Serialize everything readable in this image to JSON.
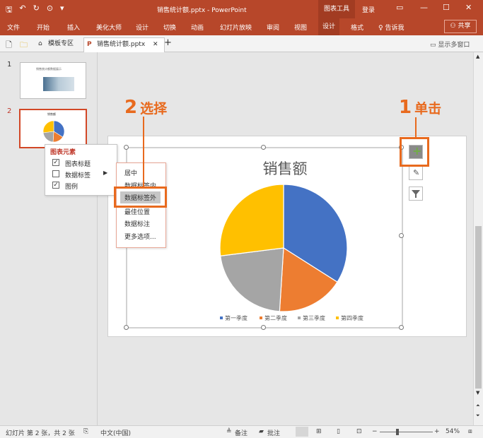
{
  "titlebar": {
    "title": "销售统计额.pptx  -  PowerPoint",
    "tools_tab": "图表工具",
    "login": "登录",
    "buttons": [
      "▭",
      "—",
      "☐",
      "✕"
    ]
  },
  "ribbon": {
    "tabs": [
      "文件",
      "开始",
      "插入",
      "美化大师",
      "设计",
      "切换",
      "动画",
      "幻灯片放映",
      "审阅",
      "视图",
      "设计",
      "格式"
    ],
    "tell_me": "告诉我",
    "share": "共享"
  },
  "tabbar": {
    "tabs": [
      "模板专区",
      "销售统计额.pptx"
    ],
    "multi_window": "显示多窗口"
  },
  "thumbnails": {
    "slide_numbers": [
      "1",
      "2"
    ],
    "slide1_title": "销售统计额数据展示",
    "slide2_title": "销售额"
  },
  "chart_elements_popup": {
    "header": "图表元素",
    "items": [
      {
        "label": "图表标题",
        "checked": true
      },
      {
        "label": "数据标签",
        "checked": false
      },
      {
        "label": "图例",
        "checked": true
      }
    ]
  },
  "label_submenu": {
    "items": [
      "居中",
      "数据标签内",
      "数据标签外",
      "最佳位置",
      "数据标注",
      "更多选项..."
    ],
    "highlighted": "数据标签外"
  },
  "annotations": {
    "step1_number": "1",
    "step1_text": "单击",
    "step2_number": "2",
    "step2_text": "选择"
  },
  "status": {
    "slide_info": "幻灯片 第 2 张，共 2 张",
    "language": "中文(中国)",
    "notes": "备注",
    "comments": "批注",
    "zoom": "54%"
  },
  "chart_data": {
    "type": "pie",
    "title": "销售额",
    "categories": [
      "第一季度",
      "第二季度",
      "第三季度",
      "第四季度"
    ],
    "values": [
      34,
      17,
      22,
      27
    ],
    "colors": [
      "#4472c4",
      "#ed7d31",
      "#a5a5a5",
      "#ffc000"
    ],
    "legend_position": "bottom"
  },
  "colors": {
    "accent": "#b7472a",
    "annotation": "#e86a1e",
    "plus_button": "#70ad47"
  }
}
